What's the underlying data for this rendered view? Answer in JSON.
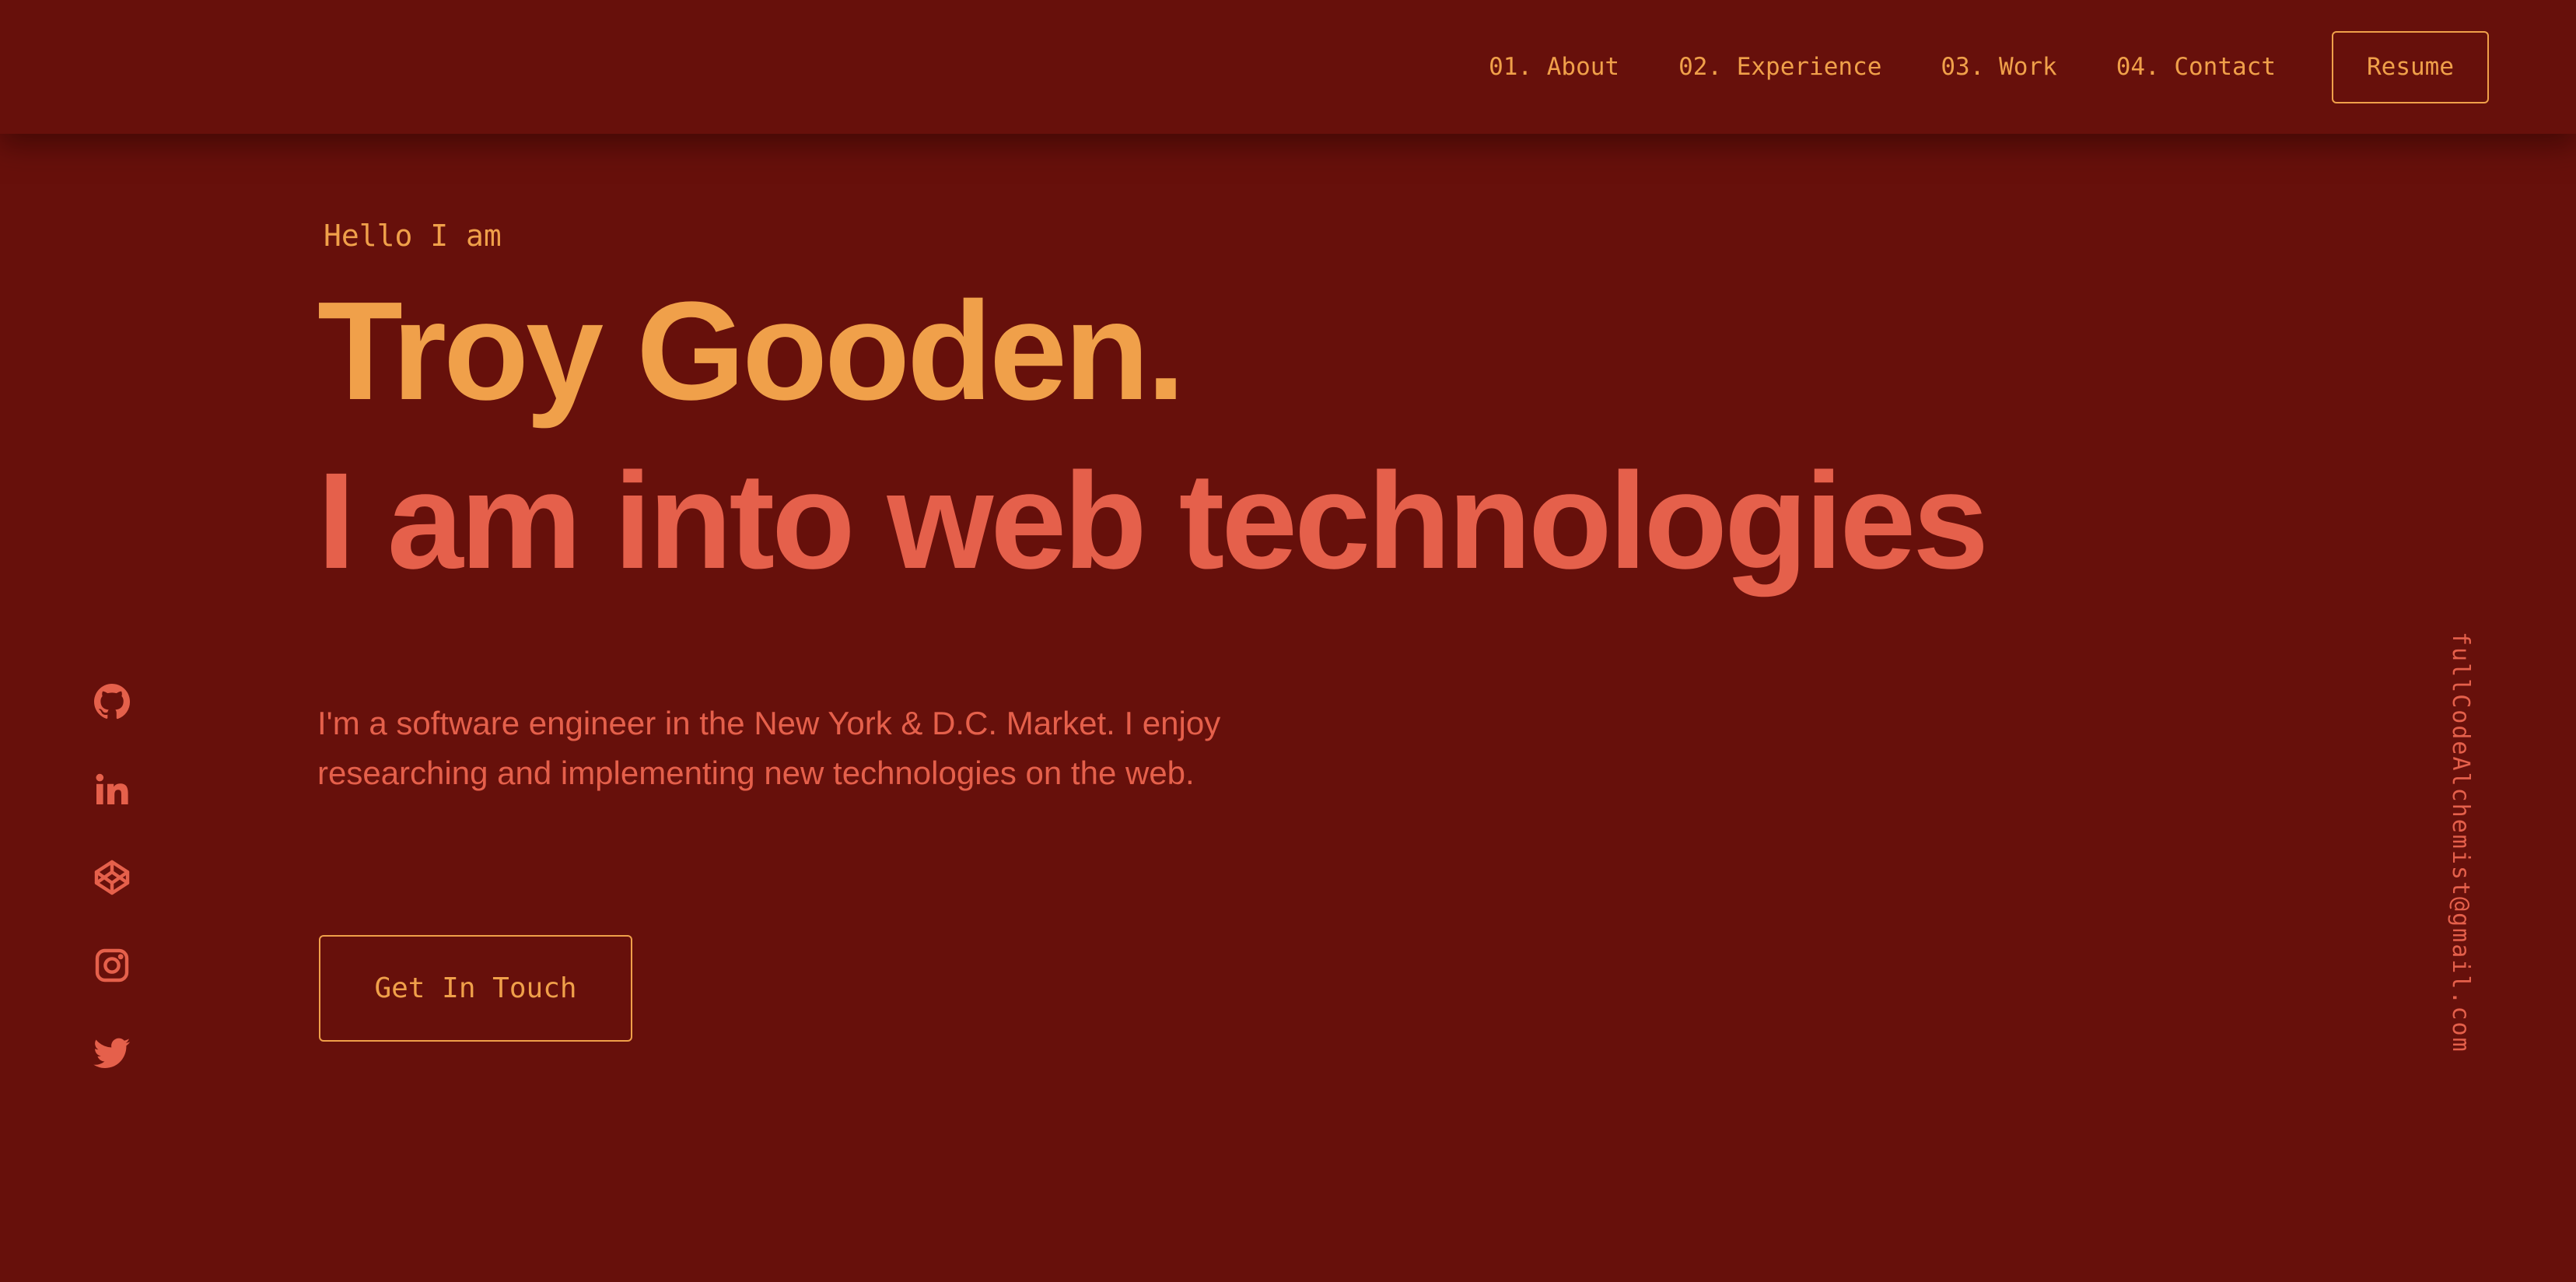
{
  "nav": {
    "links": [
      {
        "label": "01. About"
      },
      {
        "label": "02. Experience"
      },
      {
        "label": "03. Work"
      },
      {
        "label": "04. Contact"
      }
    ],
    "resume_label": "Resume"
  },
  "hero": {
    "greeting": "Hello I am",
    "name": "Troy Gooden.",
    "tagline": "I am into web technologies",
    "bio": "I'm a software engineer in the New York & D.C. Market. I enjoy researching and implementing new technologies on the web.",
    "cta_label": "Get In Touch"
  },
  "social": {
    "icons": [
      "github-icon",
      "linkedin-icon",
      "codepen-icon",
      "instagram-icon",
      "twitter-icon"
    ]
  },
  "email": "fullCodeAlchemist@gmail.com",
  "colors": {
    "background": "#67100b",
    "accent_orange": "#f0a04a",
    "accent_coral": "#e5604b"
  }
}
